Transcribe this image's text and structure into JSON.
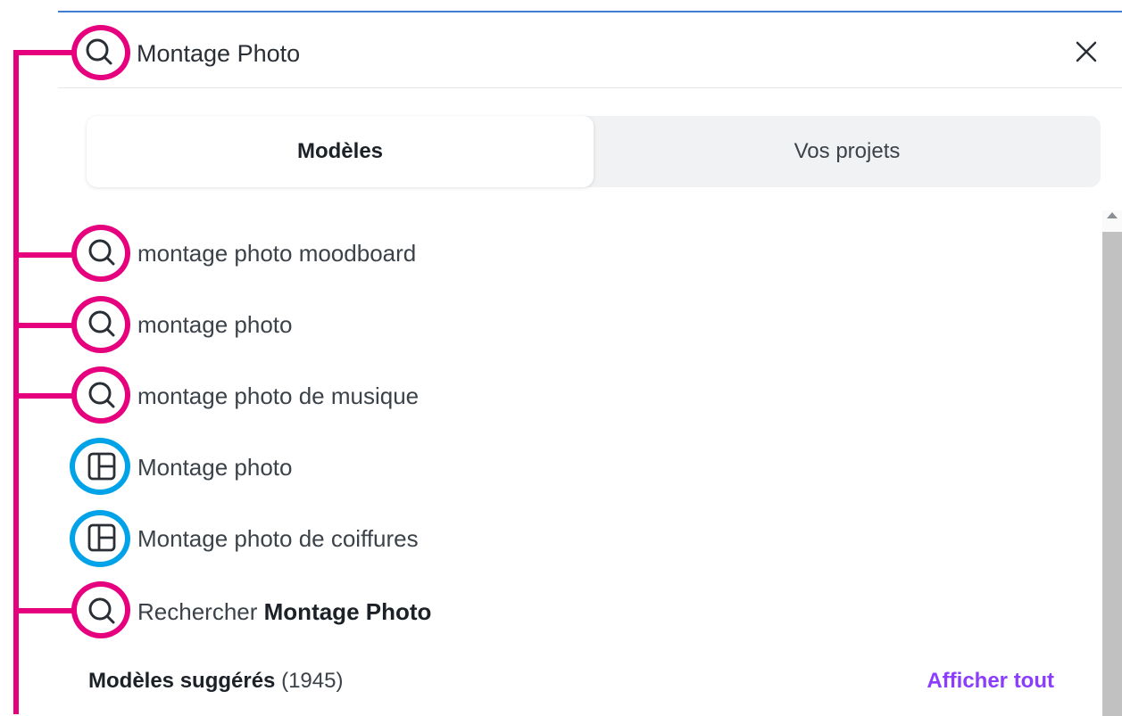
{
  "search": {
    "value": "Montage Photo",
    "close_icon": "close-icon",
    "search_icon": "search-icon"
  },
  "tabs": [
    {
      "label": "Modèles",
      "active": true
    },
    {
      "label": "Vos projets",
      "active": false
    }
  ],
  "suggestions": [
    {
      "type": "search",
      "icon": "search-icon",
      "label": "montage photo moodboard"
    },
    {
      "type": "search",
      "icon": "search-icon",
      "label": "montage photo"
    },
    {
      "type": "search",
      "icon": "search-icon",
      "label": "montage photo de musique"
    },
    {
      "type": "template",
      "icon": "template-icon",
      "label": "Montage photo"
    },
    {
      "type": "template",
      "icon": "template-icon",
      "label": "Montage photo de coiffures"
    }
  ],
  "search_all": {
    "prefix": "Rechercher",
    "term": "Montage Photo"
  },
  "footer": {
    "title": "Modèles suggérés",
    "count": "(1945)",
    "see_all": "Afficher tout"
  },
  "colors": {
    "annotation_pink": "#e6007e",
    "annotation_blue": "#00a2e8",
    "accent_purple": "#8b3dff"
  }
}
